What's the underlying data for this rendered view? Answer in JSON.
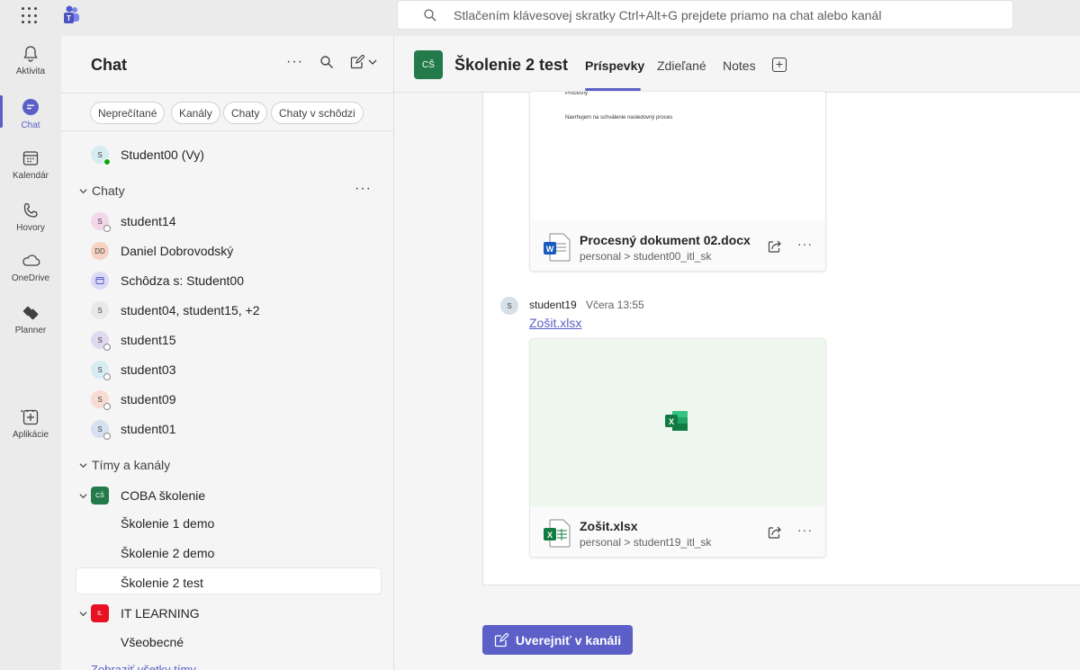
{
  "topbar": {
    "search_placeholder": "Stlačením klávesovej skratky Ctrl+Alt+G prejdete priamo na chat alebo kanál"
  },
  "rail": {
    "items": [
      {
        "label": "Aktivita",
        "icon": "bell-icon"
      },
      {
        "label": "Chat",
        "icon": "chat-icon",
        "active": true
      },
      {
        "label": "Kalendár",
        "icon": "calendar-icon"
      },
      {
        "label": "Hovory",
        "icon": "phone-icon"
      },
      {
        "label": "OneDrive",
        "icon": "cloud-icon"
      },
      {
        "label": "Planner",
        "icon": "planner-icon"
      },
      {
        "label": "Aplikácie",
        "icon": "add-apps-icon"
      }
    ],
    "more": "..."
  },
  "chatpanel": {
    "title": "Chat",
    "filters": [
      "Neprečítané",
      "Kanály",
      "Chaty",
      "Chaty v schôdzi"
    ],
    "self": {
      "label": "Student00 (Vy)",
      "initials": "S"
    },
    "chats_header": "Chaty",
    "chats": [
      {
        "label": "student14",
        "initials": "S",
        "color": "#f3d6e8"
      },
      {
        "label": "Daniel Dobrovodský",
        "initials": "DD",
        "color": "#f7d3c3"
      },
      {
        "label": "Schôdza s: Student00",
        "initials": "",
        "color": "#dcd9f7"
      },
      {
        "label": "student04, student15, +2",
        "initials": "S",
        "color": "#e8e8e8"
      },
      {
        "label": "student15",
        "initials": "S",
        "color": "#e0d9ef"
      },
      {
        "label": "student03",
        "initials": "S",
        "color": "#d6ecf3"
      },
      {
        "label": "student09",
        "initials": "S",
        "color": "#f7dcd3"
      },
      {
        "label": "student01",
        "initials": "S",
        "color": "#d6e0ee"
      }
    ],
    "teams_header": "Tímy a kanály",
    "teams": [
      {
        "name": "COBA školenie",
        "initials": "CŠ",
        "color": "#237b4b",
        "channels": [
          "Školenie 1 demo",
          "Školenie 2 demo",
          "Školenie 2 test"
        ]
      },
      {
        "name": "IT LEARNING",
        "initials": "IL",
        "color": "#e81123",
        "channels": [
          "Všeobecné"
        ]
      }
    ],
    "show_all": "Zobraziť všetky tímy"
  },
  "main": {
    "team_initials": "CŠ",
    "title": "Školenie 2 test",
    "tabs": [
      "Príspevky",
      "Zdieľané",
      "Notes"
    ],
    "doc_preview_lines": [
      "Procesný",
      "Navrhujem na schválenie nasledovný proces"
    ],
    "card1": {
      "file_name": "Procesný dokument 02.docx",
      "path": "personal > student00_itl_sk"
    },
    "message": {
      "initials": "S",
      "author": "student19",
      "time": "Včera 13:55",
      "link": "Zošit.xlsx"
    },
    "card2": {
      "file_name": "Zošit.xlsx",
      "path": "personal > student19_itl_sk"
    },
    "post_button": "Uverejniť v kanáli"
  },
  "colors": {
    "accent": "#5b5fc7",
    "excel_green": "#107c41",
    "word_blue": "#185abd"
  }
}
